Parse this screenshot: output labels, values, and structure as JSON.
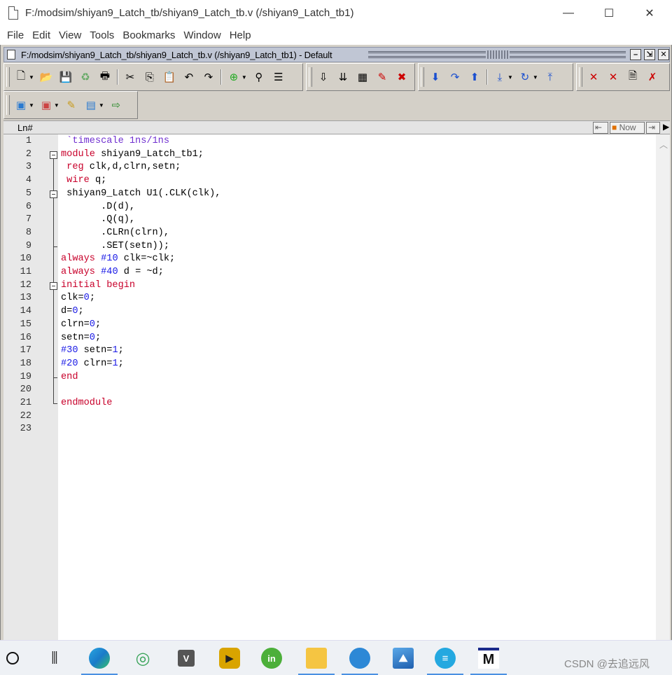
{
  "window": {
    "title": "F:/modsim/shiyan9_Latch_tb/shiyan9_Latch_tb.v (/shiyan9_Latch_tb1)",
    "minimize": "—",
    "maximize": "☐",
    "close": "✕"
  },
  "menu": [
    "File",
    "Edit",
    "View",
    "Tools",
    "Bookmarks",
    "Window",
    "Help"
  ],
  "inner": {
    "title": "F:/modsim/shiyan9_Latch_tb/shiyan9_Latch_tb.v (/shiyan9_Latch_tb1) - Default"
  },
  "editor": {
    "ln_header": "Ln#",
    "now_label": "Now",
    "lines": [
      {
        "n": "1",
        "segs": [
          {
            "c": "dir",
            "t": " `timescale 1ns/1ns"
          }
        ]
      },
      {
        "n": "2",
        "segs": [
          {
            "c": "kw",
            "t": "module"
          },
          {
            "c": "pl",
            "t": " shiyan9_Latch_tb1;"
          }
        ]
      },
      {
        "n": "3",
        "segs": [
          {
            "c": "kw",
            "t": " reg"
          },
          {
            "c": "pl",
            "t": " clk,d,clrn,setn;"
          }
        ]
      },
      {
        "n": "4",
        "segs": [
          {
            "c": "kw",
            "t": " wire"
          },
          {
            "c": "pl",
            "t": " q;"
          }
        ]
      },
      {
        "n": "5",
        "segs": [
          {
            "c": "pl",
            "t": " shiyan9_Latch U1(.CLK(clk),"
          }
        ]
      },
      {
        "n": "6",
        "segs": [
          {
            "c": "pl",
            "t": "       .D(d),"
          }
        ]
      },
      {
        "n": "7",
        "segs": [
          {
            "c": "pl",
            "t": "       .Q(q),"
          }
        ]
      },
      {
        "n": "8",
        "segs": [
          {
            "c": "pl",
            "t": "       .CLRn(clrn),"
          }
        ]
      },
      {
        "n": "9",
        "segs": [
          {
            "c": "pl",
            "t": "       .SET(setn));"
          }
        ]
      },
      {
        "n": "10",
        "segs": [
          {
            "c": "kw",
            "t": "always"
          },
          {
            "c": "pl",
            "t": " "
          },
          {
            "c": "num",
            "t": "#10"
          },
          {
            "c": "pl",
            "t": " clk=~clk;"
          }
        ]
      },
      {
        "n": "11",
        "segs": [
          {
            "c": "kw",
            "t": "always"
          },
          {
            "c": "pl",
            "t": " "
          },
          {
            "c": "num",
            "t": "#40"
          },
          {
            "c": "pl",
            "t": " d = ~d;"
          }
        ]
      },
      {
        "n": "12",
        "segs": [
          {
            "c": "kw",
            "t": "initial begin"
          }
        ]
      },
      {
        "n": "13",
        "segs": [
          {
            "c": "pl",
            "t": "clk="
          },
          {
            "c": "num",
            "t": "0"
          },
          {
            "c": "pl",
            "t": ";"
          }
        ]
      },
      {
        "n": "14",
        "segs": [
          {
            "c": "pl",
            "t": "d="
          },
          {
            "c": "num",
            "t": "0"
          },
          {
            "c": "pl",
            "t": ";"
          }
        ]
      },
      {
        "n": "15",
        "segs": [
          {
            "c": "pl",
            "t": "clrn="
          },
          {
            "c": "num",
            "t": "0"
          },
          {
            "c": "pl",
            "t": ";"
          }
        ]
      },
      {
        "n": "16",
        "segs": [
          {
            "c": "pl",
            "t": "setn="
          },
          {
            "c": "num",
            "t": "0"
          },
          {
            "c": "pl",
            "t": ";"
          }
        ]
      },
      {
        "n": "17",
        "segs": [
          {
            "c": "num",
            "t": "#30"
          },
          {
            "c": "pl",
            "t": " setn="
          },
          {
            "c": "num",
            "t": "1"
          },
          {
            "c": "pl",
            "t": ";"
          }
        ]
      },
      {
        "n": "18",
        "segs": [
          {
            "c": "num",
            "t": "#20"
          },
          {
            "c": "pl",
            "t": " clrn="
          },
          {
            "c": "num",
            "t": "1"
          },
          {
            "c": "pl",
            "t": ";"
          }
        ]
      },
      {
        "n": "19",
        "segs": [
          {
            "c": "kw",
            "t": "end"
          }
        ]
      },
      {
        "n": "20",
        "segs": []
      },
      {
        "n": "21",
        "segs": [
          {
            "c": "kw",
            "t": "endmodule"
          }
        ]
      },
      {
        "n": "22",
        "segs": []
      },
      {
        "n": "23",
        "segs": []
      }
    ]
  },
  "taskbar": {
    "watermark": "CSDN @去追远风",
    "apps": [
      "start-button",
      "task-view",
      "edge",
      "wechat-app",
      "vivado",
      "media-app",
      "inkscape-app",
      "file-explorer",
      "browser-app",
      "photos",
      "notepad-app",
      "modelsim"
    ]
  },
  "colors": {
    "keyword": "#c8002a",
    "directive": "#7030d0",
    "number": "#1a1ae6",
    "accent": "#4a90e2"
  }
}
